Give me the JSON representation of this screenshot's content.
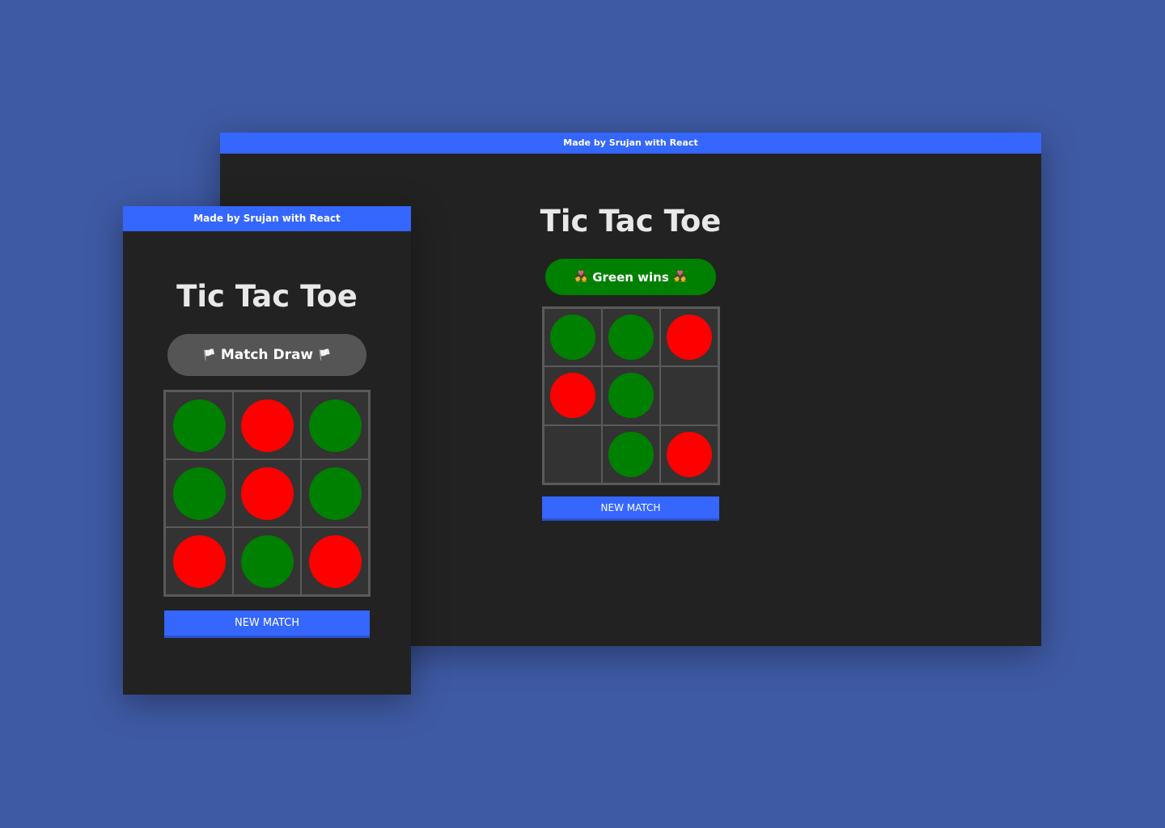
{
  "desktop": {
    "banner": "Made by Srujan with React",
    "title": "Tic Tac Toe",
    "status": {
      "emoji_left": "💑",
      "text": "Green wins",
      "emoji_right": "💑",
      "color": "#008000"
    },
    "board": [
      [
        "green",
        "green",
        "red"
      ],
      [
        "red",
        "green",
        ""
      ],
      [
        "",
        "green",
        "red"
      ]
    ],
    "button_label": "NEW MATCH"
  },
  "mobile": {
    "banner": "Made by Srujan with React",
    "title": "Tic Tac Toe",
    "status": {
      "emoji_left": "🏳️",
      "text": "Match Draw",
      "emoji_right": "🏳️",
      "color": "#555555"
    },
    "board": [
      [
        "green",
        "red",
        "green"
      ],
      [
        "green",
        "red",
        "green"
      ],
      [
        "red",
        "green",
        "red"
      ]
    ],
    "button_label": "NEW MATCH"
  },
  "colors": {
    "background": "#3f5aa4",
    "window": "#222222",
    "accent": "#3567ff",
    "green": "#008000",
    "red": "#ff0000"
  }
}
